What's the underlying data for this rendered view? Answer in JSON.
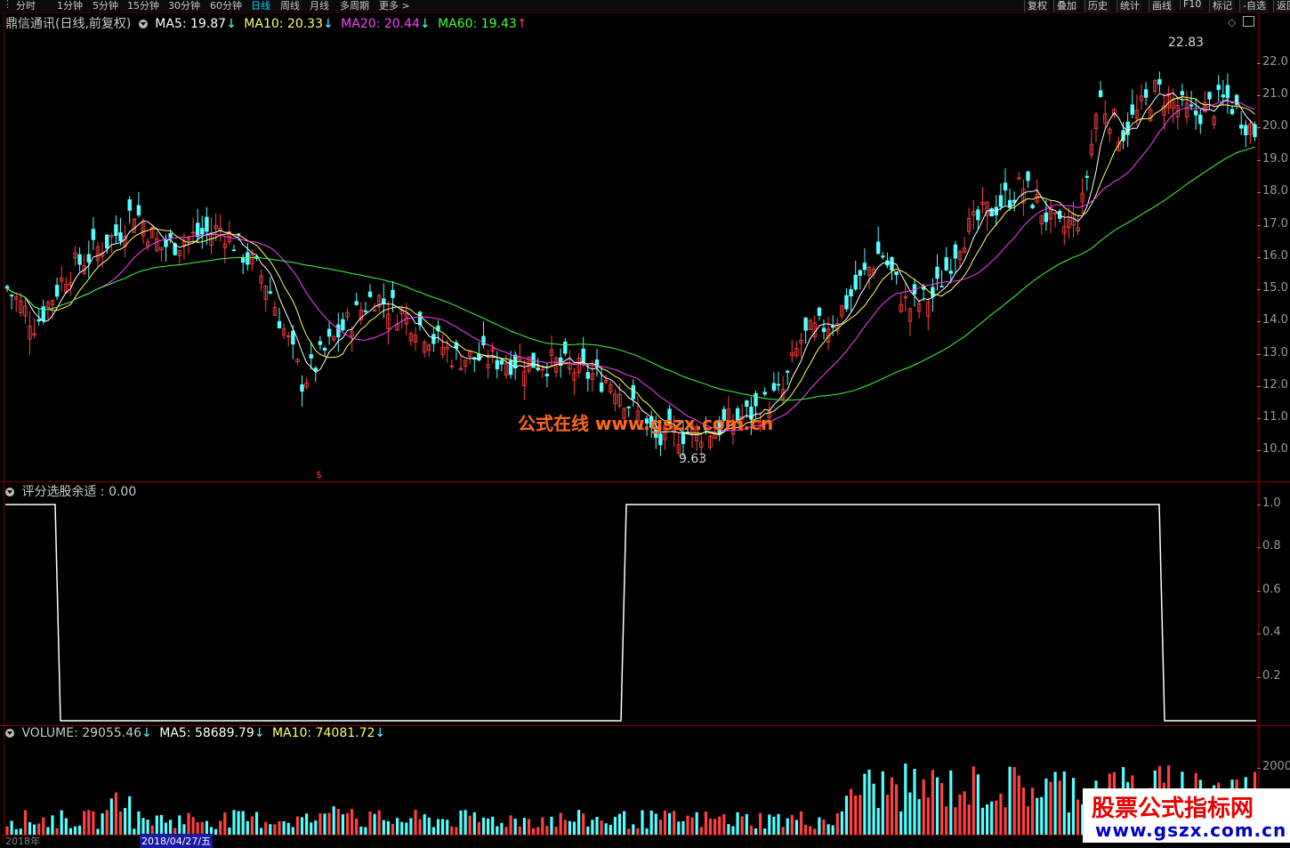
{
  "toolbar": {
    "periods": [
      "分时",
      "1分钟",
      "5分钟",
      "15分钟",
      "30分钟",
      "60分钟",
      "日线",
      "周线",
      "月线",
      "多周期",
      "更多 >"
    ],
    "active_period": "日线",
    "right_buttons": [
      "复权",
      "叠加",
      "历史",
      "统计",
      "画线",
      "F10",
      "标记",
      "-自选",
      "返回"
    ]
  },
  "main_panel": {
    "stock_title": "鼎信通讯(日线,前复权)",
    "ma5": "MA5: 19.87",
    "ma10": "MA10: 20.33",
    "ma20": "MA20: 20.44",
    "ma60": "MA60: 19.43",
    "ma5_arrow": "↓",
    "ma10_arrow": "↓",
    "ma20_arrow": "↓",
    "ma60_arrow": "↑",
    "high_label": "22.83",
    "low_label": "9.63",
    "watermark": "公式在线  www.gszx.com.cn",
    "marker": "$",
    "price_axis": [
      "22.0",
      "21.0",
      "20.0",
      "19.0",
      "18.0",
      "17.0",
      "16.0",
      "15.0",
      "14.0",
      "13.0",
      "12.0",
      "11.0",
      "10.0"
    ],
    "colors": {
      "up": "#ff4040",
      "down": "#54ffff",
      "ma5": "#ffffff",
      "ma10": "#ffff66",
      "ma20": "#ff40ff",
      "ma60": "#40ff40"
    }
  },
  "indicator_panel": {
    "title": "评分选股余适 : 0.00",
    "axis": [
      "1.0",
      "0.8",
      "0.6",
      "0.4",
      "0.2"
    ]
  },
  "volume_panel": {
    "volume": "VOLUME: 29055.46",
    "ma5": "MA5: 58689.79",
    "ma10": "MA10: 74081.72",
    "axis": [
      "2000"
    ]
  },
  "date_axis": {
    "left": "2018年",
    "cursor": "2018/04/27/五"
  },
  "brand": {
    "name": "股票公式指标网",
    "url": "www.gszx.com.cn"
  }
}
